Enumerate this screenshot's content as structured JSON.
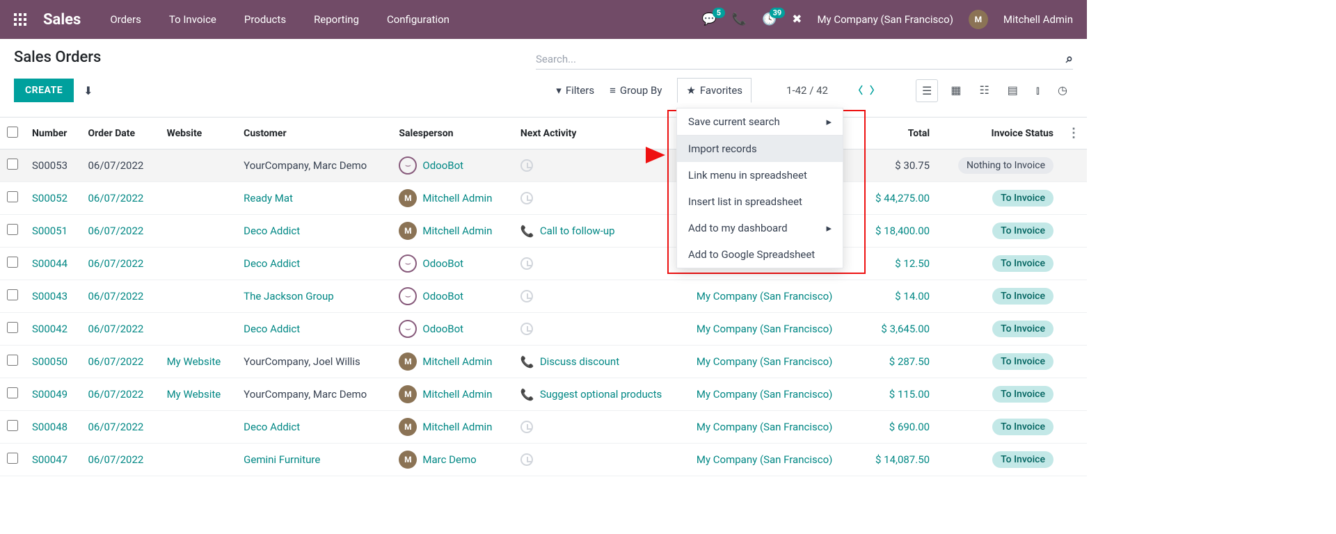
{
  "nav": {
    "brand": "Sales",
    "menu": [
      "Orders",
      "To Invoice",
      "Products",
      "Reporting",
      "Configuration"
    ],
    "messages_badge": "5",
    "activities_badge": "39",
    "company": "My Company (San Francisco)",
    "user": "Mitchell Admin"
  },
  "header": {
    "title": "Sales Orders",
    "create": "CREATE",
    "search_placeholder": "Search...",
    "filters": "Filters",
    "group_by": "Group By",
    "favorites": "Favorites",
    "pager": "1-42 / 42"
  },
  "favorites_menu": {
    "items": [
      "Save current search",
      "Import records",
      "Link menu in spreadsheet",
      "Insert list in spreadsheet",
      "Add to my dashboard",
      "Add to Google Spreadsheet"
    ]
  },
  "columns": {
    "number": "Number",
    "order_date": "Order Date",
    "website": "Website",
    "customer": "Customer",
    "salesperson": "Salesperson",
    "next_activity": "Next Activity",
    "company": "",
    "total": "Total",
    "invoice_status": "Invoice Status"
  },
  "rows": [
    {
      "num": "S00053",
      "date": "06/07/2022",
      "website": "",
      "customer": "YourCompany, Marc Demo",
      "cust_link": false,
      "sp": "OdooBot",
      "sp_bot": true,
      "activity": "",
      "act_type": "clock",
      "company": "",
      "total": "$ 30.75",
      "status": "Nothing to Invoice",
      "status_style": "gray",
      "selected": true
    },
    {
      "num": "S00052",
      "date": "06/07/2022",
      "website": "",
      "customer": "Ready Mat",
      "cust_link": true,
      "sp": "Mitchell Admin",
      "sp_bot": false,
      "activity": "",
      "act_type": "clock",
      "company": "",
      "total": "$ 44,275.00",
      "status": "To Invoice",
      "status_style": "teal"
    },
    {
      "num": "S00051",
      "date": "06/07/2022",
      "website": "",
      "customer": "Deco Addict",
      "cust_link": true,
      "sp": "Mitchell Admin",
      "sp_bot": false,
      "activity": "Call to follow-up",
      "act_type": "call-green",
      "company": "",
      "total": "$ 18,400.00",
      "status": "To Invoice",
      "status_style": "teal"
    },
    {
      "num": "S00044",
      "date": "06/07/2022",
      "website": "",
      "customer": "Deco Addict",
      "cust_link": true,
      "sp": "OdooBot",
      "sp_bot": true,
      "activity": "",
      "act_type": "clock",
      "company": "",
      "total": "$ 12.50",
      "status": "To Invoice",
      "status_style": "teal"
    },
    {
      "num": "S00043",
      "date": "06/07/2022",
      "website": "",
      "customer": "The Jackson Group",
      "cust_link": true,
      "sp": "OdooBot",
      "sp_bot": true,
      "activity": "",
      "act_type": "clock",
      "company": "My Company (San Francisco)",
      "total": "$ 14.00",
      "status": "To Invoice",
      "status_style": "teal"
    },
    {
      "num": "S00042",
      "date": "06/07/2022",
      "website": "",
      "customer": "Deco Addict",
      "cust_link": true,
      "sp": "OdooBot",
      "sp_bot": true,
      "activity": "",
      "act_type": "clock",
      "company": "My Company (San Francisco)",
      "total": "$ 3,645.00",
      "status": "To Invoice",
      "status_style": "teal"
    },
    {
      "num": "S00050",
      "date": "06/07/2022",
      "website": "My Website",
      "customer": "YourCompany, Joel Willis",
      "cust_link": false,
      "sp": "Mitchell Admin",
      "sp_bot": false,
      "activity": "Discuss discount",
      "act_type": "call-red",
      "company": "My Company (San Francisco)",
      "total": "$ 287.50",
      "status": "To Invoice",
      "status_style": "teal"
    },
    {
      "num": "S00049",
      "date": "06/07/2022",
      "website": "My Website",
      "customer": "YourCompany, Marc Demo",
      "cust_link": false,
      "sp": "Mitchell Admin",
      "sp_bot": false,
      "activity": "Suggest optional products",
      "act_type": "call-red",
      "company": "My Company (San Francisco)",
      "total": "$ 115.00",
      "status": "To Invoice",
      "status_style": "teal"
    },
    {
      "num": "S00048",
      "date": "06/07/2022",
      "website": "",
      "customer": "Deco Addict",
      "cust_link": true,
      "sp": "Mitchell Admin",
      "sp_bot": false,
      "activity": "",
      "act_type": "clock",
      "company": "My Company (San Francisco)",
      "total": "$ 690.00",
      "status": "To Invoice",
      "status_style": "teal"
    },
    {
      "num": "S00047",
      "date": "06/07/2022",
      "website": "",
      "customer": "Gemini Furniture",
      "cust_link": true,
      "sp": "Marc Demo",
      "sp_bot": false,
      "activity": "",
      "act_type": "clock",
      "company": "My Company (San Francisco)",
      "total": "$ 14,087.50",
      "status": "To Invoice",
      "status_style": "teal"
    }
  ]
}
